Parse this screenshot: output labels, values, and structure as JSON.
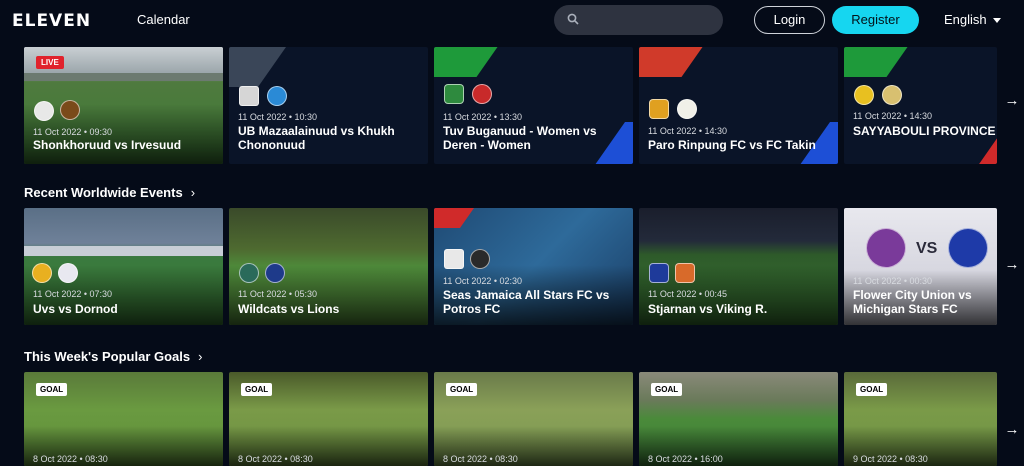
{
  "header": {
    "logo": "ELEVEN",
    "calendar": "Calendar",
    "search_placeholder": "",
    "login": "Login",
    "register": "Register",
    "language": "English"
  },
  "row1": [
    {
      "date": "11 Oct 2022 • 09:30",
      "title": "Shonkhoruud vs Irvesuud",
      "badge": "LIVE"
    },
    {
      "date": "11 Oct 2022 • 10:30",
      "title": "UB Mazaalainuud vs Khukh Chononuud"
    },
    {
      "date": "11 Oct 2022 • 13:30",
      "title": "Tuv Buganuud - Women vs Deren - Women"
    },
    {
      "date": "11 Oct 2022 • 14:30",
      "title": "Paro Rinpung FC vs FC Takin"
    },
    {
      "date": "11 Oct 2022 • 14:30",
      "title": "SAYYABOULI PROVINCE vs Luang Prabang Province"
    }
  ],
  "sections": {
    "recent": "Recent Worldwide Events",
    "goals": "This Week's Popular Goals"
  },
  "row2": [
    {
      "date": "11 Oct 2022 • 07:30",
      "title": "Uvs vs Dornod"
    },
    {
      "date": "11 Oct 2022 • 05:30",
      "title": "Wildcats vs Lions"
    },
    {
      "date": "11 Oct 2022 • 02:30",
      "title": "Seas Jamaica All Stars FC vs Potros FC"
    },
    {
      "date": "11 Oct 2022 • 00:45",
      "title": "Stjarnan vs Viking R."
    },
    {
      "date": "11 Oct 2022 • 00:30",
      "title": "Flower City Union vs Michigan Stars FC",
      "overlay_vs": "VS"
    }
  ],
  "row3": [
    {
      "date": "8 Oct 2022 • 08:30",
      "badge": "GOAL"
    },
    {
      "date": "8 Oct 2022 • 08:30",
      "badge": "GOAL"
    },
    {
      "date": "8 Oct 2022 • 08:30",
      "badge": "GOAL"
    },
    {
      "date": "8 Oct 2022 • 16:00",
      "badge": "GOAL"
    },
    {
      "date": "9 Oct 2022 • 08:30",
      "badge": "GOAL"
    }
  ],
  "icons": {
    "next_arrow": "→",
    "chevron_right": "›"
  }
}
